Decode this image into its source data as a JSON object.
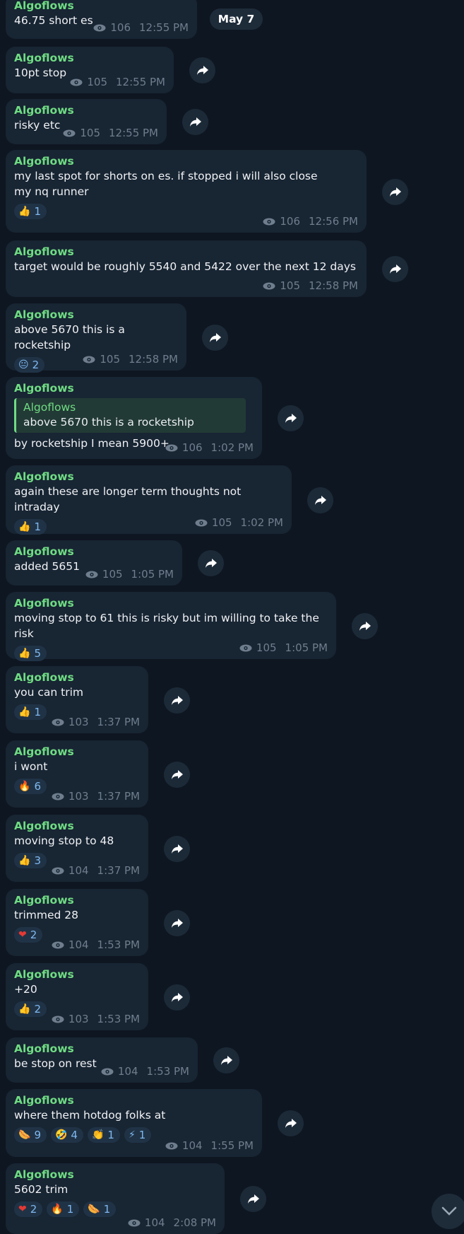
{
  "date_badge": "May 7",
  "colors": {
    "background": "#0e1621",
    "bubble": "#182533",
    "sender": "#6fdc83",
    "meta": "#6f7e8d",
    "reaction_count": "#7fb8f0"
  },
  "messages": [
    {
      "sender": "Algoflows",
      "text": "46.75 short es",
      "views": "106",
      "time": "12:55 PM",
      "reactions": []
    },
    {
      "sender": "Algoflows",
      "text": "10pt stop",
      "views": "105",
      "time": "12:55 PM",
      "reactions": []
    },
    {
      "sender": "Algoflows",
      "text": "risky etc",
      "views": "105",
      "time": "12:55 PM",
      "reactions": []
    },
    {
      "sender": "Algoflows",
      "text": "my last spot for shorts on es. if stopped i will also close my nq runner",
      "views": "106",
      "time": "12:56 PM",
      "reactions": [
        {
          "emoji": "👍",
          "count": "1"
        }
      ]
    },
    {
      "sender": "Algoflows",
      "text": "target would be roughly 5540 and 5422 over the next 12 days",
      "views": "105",
      "time": "12:58 PM",
      "reactions": []
    },
    {
      "sender": "Algoflows",
      "text": "above 5670 this is a rocketship",
      "views": "105",
      "time": "12:58 PM",
      "reactions": [
        {
          "emoji": "😐",
          "count": "2"
        }
      ]
    },
    {
      "sender": "Algoflows",
      "reply": {
        "sender": "Algoflows",
        "text": "above 5670 this is a rocketship"
      },
      "text": "by rocketship I mean 5900+",
      "views": "106",
      "time": "1:02 PM",
      "reactions": []
    },
    {
      "sender": "Algoflows",
      "text": "again these are longer term thoughts not intraday",
      "views": "105",
      "time": "1:02 PM",
      "reactions": [
        {
          "emoji": "👍",
          "count": "1"
        }
      ]
    },
    {
      "sender": "Algoflows",
      "text": "added  5651",
      "views": "105",
      "time": "1:05 PM",
      "reactions": []
    },
    {
      "sender": "Algoflows",
      "text": "moving stop to 61 this is risky but im willing to take the risk",
      "views": "105",
      "time": "1:05 PM",
      "reactions": [
        {
          "emoji": "👍",
          "count": "5"
        }
      ]
    },
    {
      "sender": "Algoflows",
      "text": "you can trim",
      "views": "103",
      "time": "1:37 PM",
      "reactions": [
        {
          "emoji": "👍",
          "count": "1"
        }
      ]
    },
    {
      "sender": "Algoflows",
      "text": "i wont",
      "views": "103",
      "time": "1:37 PM",
      "reactions": [
        {
          "emoji": "🔥",
          "count": "6"
        }
      ]
    },
    {
      "sender": "Algoflows",
      "text": "moving stop to 48",
      "views": "104",
      "time": "1:37 PM",
      "reactions": [
        {
          "emoji": "👍",
          "count": "3"
        }
      ]
    },
    {
      "sender": "Algoflows",
      "text": "trimmed 28",
      "views": "104",
      "time": "1:53 PM",
      "reactions": [
        {
          "emoji": "❤",
          "count": "2"
        }
      ]
    },
    {
      "sender": "Algoflows",
      "text": "+20",
      "views": "103",
      "time": "1:53 PM",
      "reactions": [
        {
          "emoji": "👍",
          "count": "2"
        }
      ]
    },
    {
      "sender": "Algoflows",
      "text": "be stop on rest",
      "views": "104",
      "time": "1:53 PM",
      "reactions": []
    },
    {
      "sender": "Algoflows",
      "text": "where them hotdog folks at",
      "views": "104",
      "time": "1:55 PM",
      "reactions": [
        {
          "emoji": "🌭",
          "count": "9"
        },
        {
          "emoji": "🤣",
          "count": "4"
        },
        {
          "emoji": "👏",
          "count": "1"
        },
        {
          "emoji": "⚡",
          "count": "1"
        }
      ]
    },
    {
      "sender": "Algoflows",
      "text": "5602 trim",
      "views": "104",
      "time": "2:08 PM",
      "reactions": [
        {
          "emoji": "❤",
          "count": "2"
        },
        {
          "emoji": "🔥",
          "count": "1"
        },
        {
          "emoji": "🌭",
          "count": "1"
        }
      ]
    }
  ]
}
